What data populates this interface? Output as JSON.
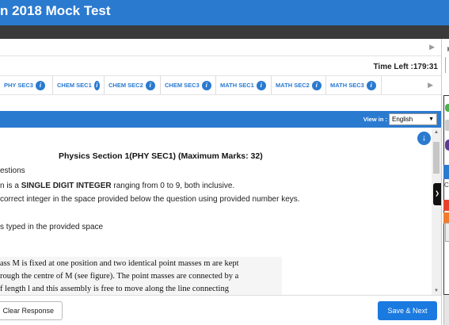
{
  "header": {
    "title": "n 2018 Mock Test"
  },
  "timer": {
    "label": "Time Left :179:31"
  },
  "tabs": [
    {
      "label": "PHY SEC3"
    },
    {
      "label": "CHEM SEC1"
    },
    {
      "label": "CHEM SEC2"
    },
    {
      "label": "CHEM SEC3"
    },
    {
      "label": "MATH SEC1"
    },
    {
      "label": "MATH SEC2"
    },
    {
      "label": "MATH SEC3"
    }
  ],
  "language": {
    "label": "View in :",
    "selected": "English"
  },
  "instructions": {
    "section_title": "Physics Section 1(PHY SEC1) (Maximum Marks: 32)",
    "line1": "estions",
    "line2_pre": "n is a ",
    "line2_bold": "SINGLE DIGIT INTEGER",
    "line2_post": " ranging from 0 to 9, both inclusive.",
    "line3": "correct integer in the space provided below the question using provided number keys.",
    "line4": "s typed in the provided space"
  },
  "question": {
    "line1": "ass M is fixed at one position and two identical point masses m are kept",
    "line2": "rough the centre of M (see figure). The point masses are connected by a",
    "line3": "f length l and this assembly is free to move along the line connecting"
  },
  "footer": {
    "clear_label": "Clear Response",
    "save_label": "Save & Next"
  },
  "sidepanel": {
    "letter": "C"
  },
  "colors": {
    "primary": "#2a7ad0",
    "dark": "#3a3a3a",
    "save": "#1b7ae0"
  }
}
